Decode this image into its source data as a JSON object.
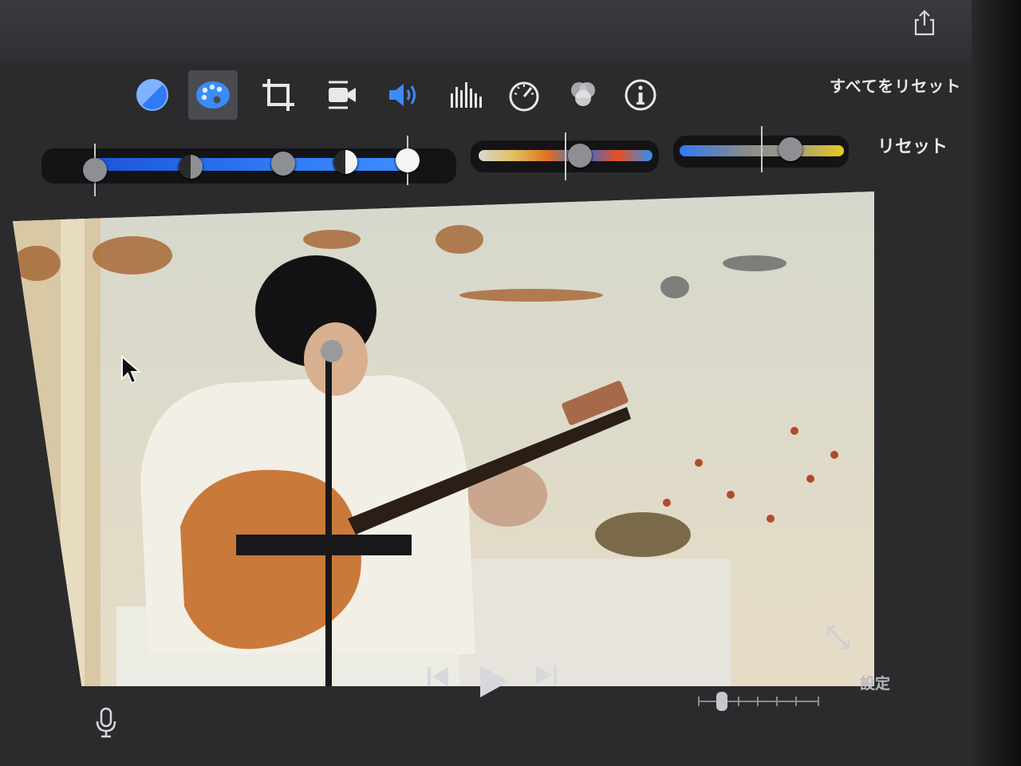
{
  "header": {
    "share_icon": "share-icon"
  },
  "toolbar": {
    "tools": [
      {
        "name": "color-balance-icon",
        "active": false
      },
      {
        "name": "color-palette-icon",
        "active": true
      },
      {
        "name": "crop-icon",
        "active": false
      },
      {
        "name": "stabilization-icon",
        "active": false
      },
      {
        "name": "volume-icon",
        "active": false
      },
      {
        "name": "equalizer-icon",
        "active": false
      },
      {
        "name": "speed-icon",
        "active": false
      },
      {
        "name": "filter-icon",
        "active": false
      },
      {
        "name": "info-icon",
        "active": false
      }
    ],
    "reset_all_label": "すべてをリセット"
  },
  "adjustments": {
    "reset_label": "リセット",
    "accent": "#2f7bf5"
  },
  "viewer": {
    "playback": {
      "previous_icon": "skip-back-icon",
      "play_icon": "play-icon",
      "next_icon": "skip-forward-icon"
    },
    "fullscreen_icon": "expand-icon"
  },
  "footer": {
    "settings_label": "設定",
    "mic_icon": "microphone-icon",
    "zoom_slider": "timeline-zoom"
  }
}
